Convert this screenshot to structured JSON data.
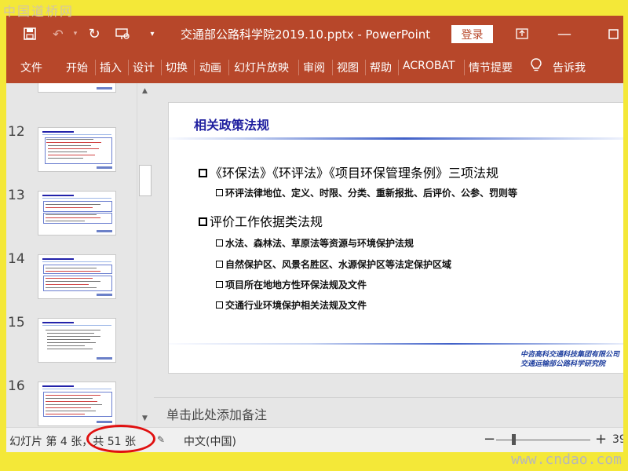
{
  "watermarks": {
    "top": "中国道桥网",
    "bottom": "www.cndao.com"
  },
  "titlebar": {
    "document_title": "交通部公路科学院2019.10.pptx  -  PowerPoint",
    "login_label": "登录",
    "icons": {
      "save": "save-icon",
      "undo": "undo-icon",
      "redo": "repeat-icon",
      "present": "present-from-start-icon",
      "customize": "customize-toolbar-icon",
      "ribbon_display": "ribbon-display-options-icon",
      "minimize": "minimize-icon",
      "maximize": "maximize-icon"
    }
  },
  "ribbon": {
    "tabs": [
      "文件",
      "开始",
      "插入",
      "设计",
      "切换",
      "动画",
      "幻灯片放映",
      "审阅",
      "视图",
      "帮助",
      "ACROBAT",
      "情节提要"
    ],
    "tell_me": "告诉我"
  },
  "thumbnails": [
    {
      "number": "12"
    },
    {
      "number": "13"
    },
    {
      "number": "14"
    },
    {
      "number": "15"
    },
    {
      "number": "16"
    }
  ],
  "slide": {
    "title": "相关政策法规",
    "bullets": [
      {
        "level": 1,
        "text": "《环保法》《环评法》《项目环保管理条例》三项法规"
      },
      {
        "level": 2,
        "text": "环评法律地位、定义、时限、分类、重新报批、后评价、公参、罚则等"
      },
      {
        "level": 1,
        "text": "评价工作依据类法规"
      },
      {
        "level": 2,
        "text": "水法、森林法、草原法等资源与环境保护法规"
      },
      {
        "level": 2,
        "text": "自然保护区、风景名胜区、水源保护区等法定保护区域"
      },
      {
        "level": 2,
        "text": "项目所在地地方性环保法规及文件"
      },
      {
        "level": 2,
        "text": "交通行业环境保护相关法规及文件"
      }
    ],
    "company_line1": "中咨高科交通科技集团有限公司",
    "company_line2": "交通运输部公路科学研究院"
  },
  "notes": {
    "placeholder": "单击此处添加备注"
  },
  "status": {
    "slide_info": "幻灯片 第 4 张，共 51 张",
    "language": "中文(中国)",
    "zoom_minus": "−",
    "zoom_plus": "+",
    "zoom_value": "39",
    "zoom_level": 0.18
  },
  "colors": {
    "ribbon": "#b7472a",
    "slide_title": "#1f1f9f",
    "annotation": "#e01010",
    "frame": "#f4e838"
  }
}
